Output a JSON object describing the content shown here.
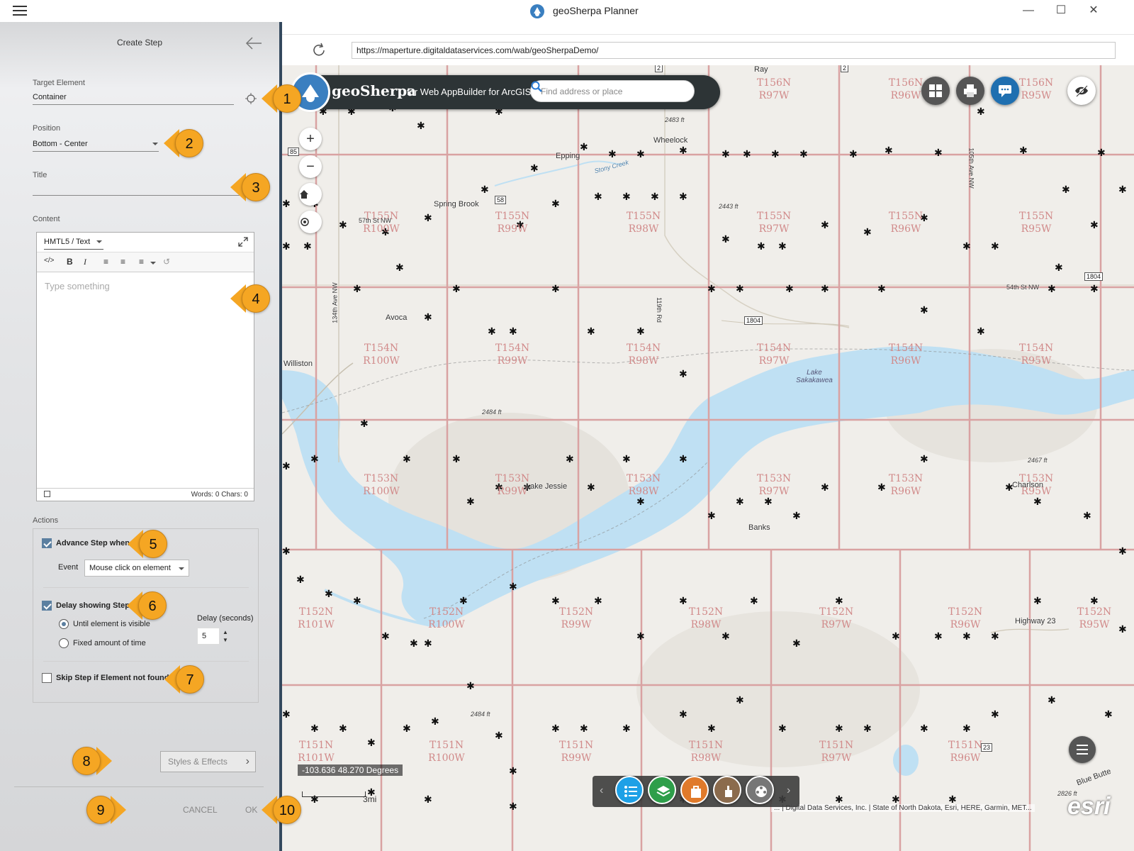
{
  "window": {
    "title": "geoSherpa Planner",
    "minimize": "—",
    "maximize": "☐",
    "close": "✕"
  },
  "browser": {
    "url": "https://maperture.digitaldataservices.com/wab/geoSherpaDemo/"
  },
  "panel": {
    "title": "Create Step",
    "target_label": "Target Element",
    "target_value": "Container",
    "position_label": "Position",
    "position_value": "Bottom - Center",
    "title_label": "Title",
    "title_value": "",
    "content_label": "Content",
    "editor": {
      "mode": "HMTL5 / Text",
      "tools": [
        "</>",
        "B",
        "I",
        "≡",
        "≡",
        "≡",
        "↺"
      ],
      "placeholder": "Type something",
      "counts": "Words: 0      Chars: 0"
    },
    "actions_label": "Actions",
    "advance": {
      "label": "Advance Step when",
      "checked": true
    },
    "event_label": "Event",
    "event_value": "Mouse click on element",
    "delay": {
      "label": "Delay showing Step",
      "checked": true
    },
    "until_visible": "Until element is visible",
    "fixed_time": "Fixed amount of time",
    "delay_seconds_label": "Delay (seconds)",
    "delay_seconds_value": "5",
    "skip": {
      "label": "Skip Step if Element not found",
      "checked": false
    },
    "styles_button": "Styles & Effects",
    "cancel": "CANCEL",
    "ok": "OK"
  },
  "callouts": [
    "1",
    "2",
    "3",
    "4",
    "5",
    "6",
    "7",
    "8",
    "9",
    "10"
  ],
  "map": {
    "header_name": "geoSherpa",
    "header_sub": "for Web AppBuilder for ArcGIS",
    "search_placeholder": "Find address or place",
    "zoom_in": "+",
    "zoom_out": "−",
    "coordinates": "-103.636 48.270 Degrees",
    "scale": "3mi",
    "attribution": "... | Digital Data Services, Inc. | State of North Dakota, Esri, HERE, Garmin, MET...",
    "esri": "esri",
    "townships": [
      [
        "T156N",
        "R97W"
      ],
      [
        "T156N",
        "R96W"
      ],
      [
        "T156N",
        "R95W"
      ],
      [
        "T155N",
        "R100W"
      ],
      [
        "T155N",
        "R99W"
      ],
      [
        "T155N",
        "R98W"
      ],
      [
        "T155N",
        "R97W"
      ],
      [
        "T155N",
        "R96W"
      ],
      [
        "T155N",
        "R95W"
      ],
      [
        "T154N",
        "R100W"
      ],
      [
        "T154N",
        "R99W"
      ],
      [
        "T154N",
        "R98W"
      ],
      [
        "T154N",
        "R97W"
      ],
      [
        "T154N",
        "R96W"
      ],
      [
        "T154N",
        "R95W"
      ],
      [
        "T153N",
        "R100W"
      ],
      [
        "T153N",
        "R99W"
      ],
      [
        "T153N",
        "R98W"
      ],
      [
        "T153N",
        "R97W"
      ],
      [
        "T153N",
        "R96W"
      ],
      [
        "T153N",
        "R95W"
      ],
      [
        "T152N",
        "R101W"
      ],
      [
        "T152N",
        "R100W"
      ],
      [
        "T152N",
        "R99W"
      ],
      [
        "T152N",
        "R98W"
      ],
      [
        "T152N",
        "R97W"
      ],
      [
        "T152N",
        "R96W"
      ],
      [
        "T152N",
        "R95W"
      ],
      [
        "T151N",
        "R101W"
      ],
      [
        "T151N",
        "R100W"
      ],
      [
        "T151N",
        "R99W"
      ],
      [
        "T151N",
        "R98W"
      ],
      [
        "T151N",
        "R97W"
      ],
      [
        "T151N",
        "R96W"
      ]
    ],
    "places": [
      "Wheelock",
      "Epping",
      "Spring Brook",
      "Avoca",
      "Williston",
      "Lake Jessie",
      "Banks",
      "Charlson",
      "Lake Sakakawea",
      "Highway 23",
      "Blue Butte",
      "Stony Creek",
      "Ray",
      "54th St NW",
      "57th St NW",
      "134th Ave NW",
      "119th Rd",
      "105th Ave NW"
    ],
    "elevations": [
      "2483 ft",
      "2443 ft",
      "2484 ft",
      "2467 ft",
      "2484 ft",
      "2826 ft"
    ],
    "highways": [
      "2",
      "2",
      "85",
      "1804",
      "1804",
      "23",
      "58"
    ]
  },
  "colors": {
    "accent": "#f5a623",
    "panel_border": "#34495e",
    "checkbox": "#5b7fa0",
    "grid": "#d9a2a2",
    "water": "#bfe0f3",
    "township_label": "#d18a8a"
  }
}
